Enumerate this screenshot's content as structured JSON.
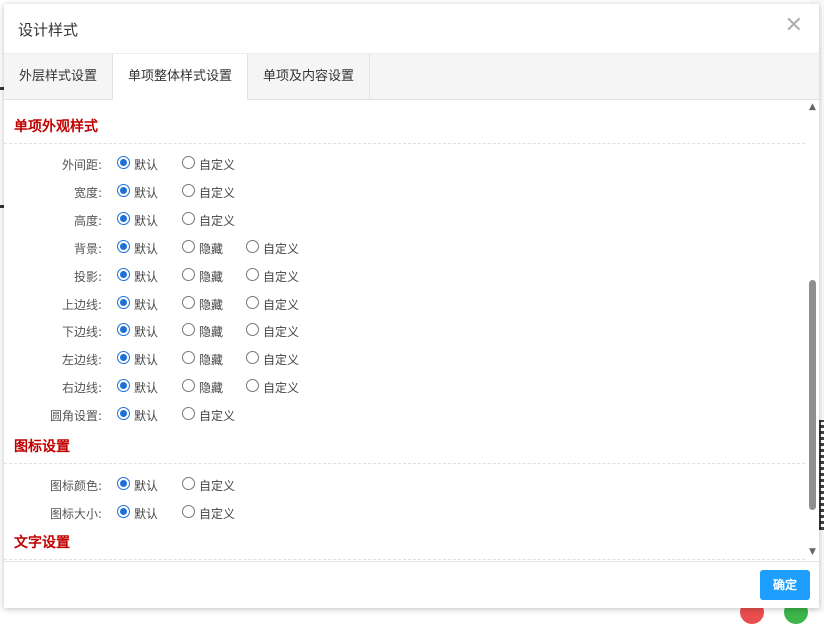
{
  "dialog": {
    "title": "设计样式",
    "close_icon": "close-icon",
    "tabs": [
      {
        "label": "外层样式设置",
        "active": false
      },
      {
        "label": "单项整体样式设置",
        "active": true
      },
      {
        "label": "单项及内容设置",
        "active": false
      }
    ],
    "confirm_label": "确定"
  },
  "sections": [
    {
      "title": "单项外观样式",
      "rows": [
        {
          "label": "外间距:",
          "options": [
            "默认",
            "自定义"
          ],
          "selected": "默认"
        },
        {
          "label": "宽度:",
          "options": [
            "默认",
            "自定义"
          ],
          "selected": "默认"
        },
        {
          "label": "高度:",
          "options": [
            "默认",
            "自定义"
          ],
          "selected": "默认"
        },
        {
          "label": "背景:",
          "options": [
            "默认",
            "隐藏",
            "自定义"
          ],
          "selected": "默认"
        },
        {
          "label": "投影:",
          "options": [
            "默认",
            "隐藏",
            "自定义"
          ],
          "selected": "默认"
        },
        {
          "label": "上边线:",
          "options": [
            "默认",
            "隐藏",
            "自定义"
          ],
          "selected": "默认"
        },
        {
          "label": "下边线:",
          "options": [
            "默认",
            "隐藏",
            "自定义"
          ],
          "selected": "默认"
        },
        {
          "label": "左边线:",
          "options": [
            "默认",
            "隐藏",
            "自定义"
          ],
          "selected": "默认"
        },
        {
          "label": "右边线:",
          "options": [
            "默认",
            "隐藏",
            "自定义"
          ],
          "selected": "默认"
        },
        {
          "label": "圆角设置:",
          "options": [
            "默认",
            "自定义"
          ],
          "selected": "默认"
        }
      ]
    },
    {
      "title": "图标设置",
      "rows": [
        {
          "label": "图标颜色:",
          "options": [
            "默认",
            "自定义"
          ],
          "selected": "默认"
        },
        {
          "label": "图标大小:",
          "options": [
            "默认",
            "自定义"
          ],
          "selected": "默认"
        }
      ]
    },
    {
      "title": "文字设置",
      "rows": []
    }
  ],
  "colors": {
    "section_title": "#c00000",
    "radio_checked": "#1e6fd9",
    "confirm_button": "#1e9fff"
  }
}
